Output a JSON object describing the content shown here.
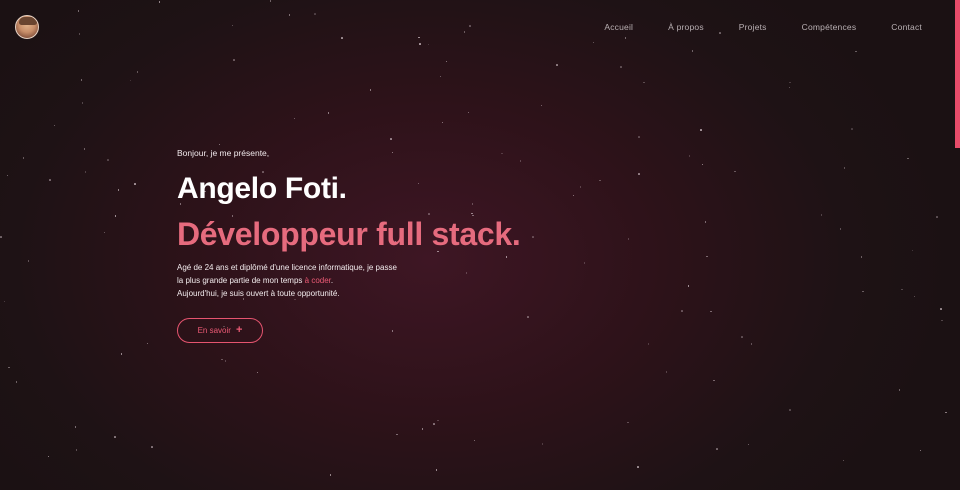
{
  "nav": {
    "items": [
      {
        "label": "Accueil"
      },
      {
        "label": "À propos"
      },
      {
        "label": "Projets"
      },
      {
        "label": "Compétences"
      },
      {
        "label": "Contact"
      }
    ]
  },
  "hero": {
    "greeting": "Bonjour, je me présente,",
    "name": "Angelo Foti.",
    "role": "Développeur full stack.",
    "description": {
      "line1": "Agé de 24 ans et diplômé d'une licence informatique, je passe",
      "line2_prefix": "la plus grande partie de mon temps ",
      "line2_accent": "à coder",
      "line2_suffix": ".",
      "line3": "Aujourd'hui, je suis ouvert à toute opportunité."
    },
    "cta": {
      "label": "En savoir",
      "icon": "plus-icon"
    }
  },
  "colors": {
    "accent": "#e66b7e",
    "accent_strong": "#ec5a75",
    "background": "#2d1219",
    "nav_text": "#b9b0b3"
  },
  "icons": {
    "avatar": "profile-photo",
    "cta": "plus-icon"
  }
}
